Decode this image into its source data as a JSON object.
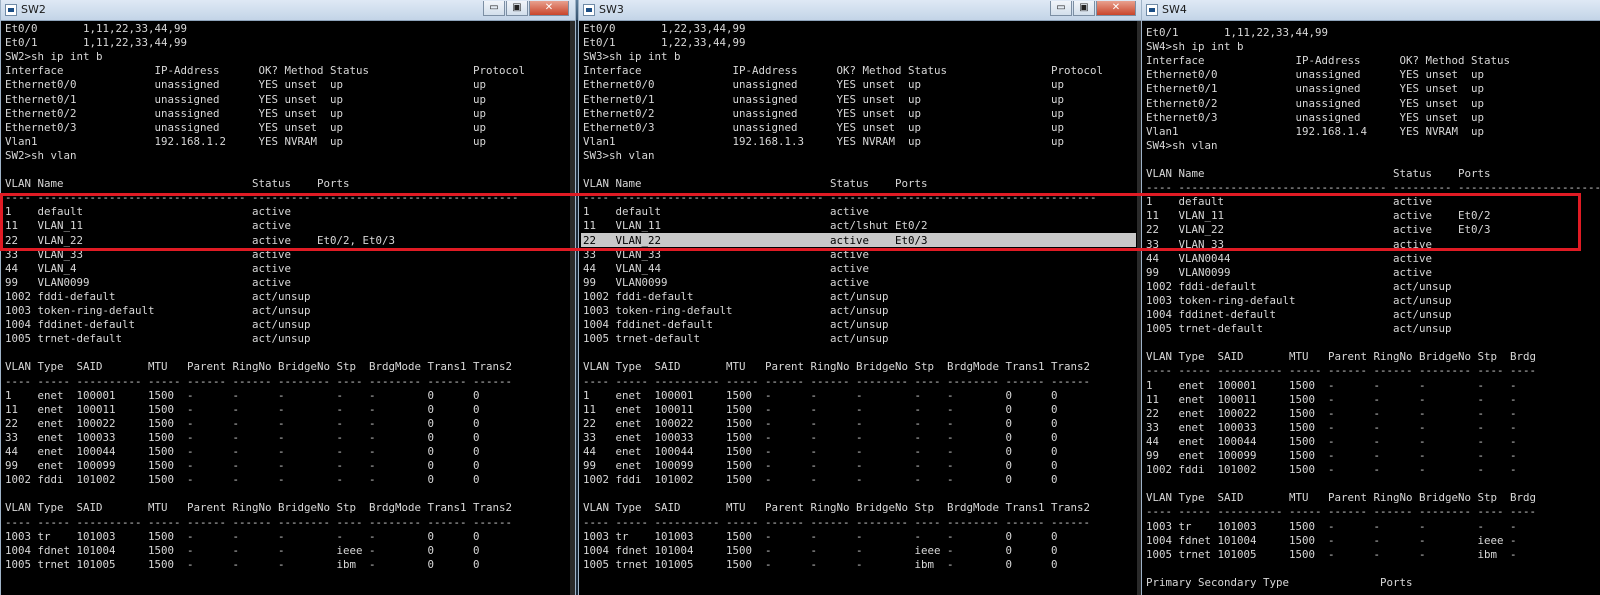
{
  "windows": [
    {
      "id": "sw2",
      "title": "SW2",
      "buttons": {
        "minimize": "▭",
        "restore": "▣",
        "close": "✕"
      },
      "lines": [
        "Et0/0       1,11,22,33,44,99",
        "Et0/1       1,11,22,33,44,99",
        "SW2>sh ip int b",
        "Interface              IP-Address      OK? Method Status                Protocol",
        "Ethernet0/0            unassigned      YES unset  up                    up",
        "Ethernet0/1            unassigned      YES unset  up                    up",
        "Ethernet0/2            unassigned      YES unset  up                    up",
        "Ethernet0/3            unassigned      YES unset  up                    up",
        "Vlan1                  192.168.1.2     YES NVRAM  up                    up",
        "SW2>sh vlan",
        "",
        "VLAN Name                             Status    Ports",
        "---- -------------------------------- --------- -------------------------------",
        "1    default                          active",
        "11   VLAN_11                          active",
        "22   VLAN_22                          active    Et0/2, Et0/3",
        "33   VLAN_33                          active",
        "44   VLAN_4                           active",
        "99   VLAN0099                         active",
        "1002 fddi-default                     act/unsup",
        "1003 token-ring-default               act/unsup",
        "1004 fddinet-default                  act/unsup",
        "1005 trnet-default                    act/unsup",
        "",
        "VLAN Type  SAID       MTU   Parent RingNo BridgeNo Stp  BrdgMode Trans1 Trans2",
        "---- ----- ---------- ----- ------ ------ -------- ---- -------- ------ ------",
        "1    enet  100001     1500  -      -      -        -    -        0      0",
        "11   enet  100011     1500  -      -      -        -    -        0      0",
        "22   enet  100022     1500  -      -      -        -    -        0      0",
        "33   enet  100033     1500  -      -      -        -    -        0      0",
        "44   enet  100044     1500  -      -      -        -    -        0      0",
        "99   enet  100099     1500  -      -      -        -    -        0      0",
        "1002 fddi  101002     1500  -      -      -        -    -        0      0",
        "",
        "VLAN Type  SAID       MTU   Parent RingNo BridgeNo Stp  BrdgMode Trans1 Trans2",
        "---- ----- ---------- ----- ------ ------ -------- ---- -------- ------ ------",
        "1003 tr    101003     1500  -      -      -        -    -        0      0",
        "1004 fdnet 101004     1500  -      -      -        ieee -        0      0",
        "1005 trnet 101005     1500  -      -      -        ibm  -        0      0"
      ]
    },
    {
      "id": "sw3",
      "title": "SW3",
      "buttons": {
        "minimize": "▭",
        "restore": "▣",
        "close": "✕"
      },
      "highlight_line": 15,
      "lines": [
        "Et0/0       1,22,33,44,99",
        "Et0/1       1,22,33,44,99",
        "SW3>sh ip int b",
        "Interface              IP-Address      OK? Method Status                Protocol",
        "Ethernet0/0            unassigned      YES unset  up                    up",
        "Ethernet0/1            unassigned      YES unset  up                    up",
        "Ethernet0/2            unassigned      YES unset  up                    up",
        "Ethernet0/3            unassigned      YES unset  up                    up",
        "Vlan1                  192.168.1.3     YES NVRAM  up                    up",
        "SW3>sh vlan",
        "",
        "VLAN Name                             Status    Ports",
        "---- -------------------------------- --------- -------------------------------",
        "1    default                          active",
        "11   VLAN_11                          act/lshut Et0/2",
        "22   VLAN_22                          active    Et0/3",
        "33   VLAN_33                          active",
        "44   VLAN_44                          active",
        "99   VLAN0099                         active",
        "1002 fddi-default                     act/unsup",
        "1003 token-ring-default               act/unsup",
        "1004 fddinet-default                  act/unsup",
        "1005 trnet-default                    act/unsup",
        "",
        "VLAN Type  SAID       MTU   Parent RingNo BridgeNo Stp  BrdgMode Trans1 Trans2",
        "---- ----- ---------- ----- ------ ------ -------- ---- -------- ------ ------",
        "1    enet  100001     1500  -      -      -        -    -        0      0",
        "11   enet  100011     1500  -      -      -        -    -        0      0",
        "22   enet  100022     1500  -      -      -        -    -        0      0",
        "33   enet  100033     1500  -      -      -        -    -        0      0",
        "44   enet  100044     1500  -      -      -        -    -        0      0",
        "99   enet  100099     1500  -      -      -        -    -        0      0",
        "1002 fddi  101002     1500  -      -      -        -    -        0      0",
        "",
        "VLAN Type  SAID       MTU   Parent RingNo BridgeNo Stp  BrdgMode Trans1 Trans2",
        "---- ----- ---------- ----- ------ ------ -------- ---- -------- ------ ------",
        "1003 tr    101003     1500  -      -      -        -    -        0      0",
        "1004 fdnet 101004     1500  -      -      -        ieee -        0      0",
        "1005 trnet 101005     1500  -      -      -        ibm  -        0      0"
      ]
    },
    {
      "id": "sw4",
      "title": "SW4",
      "buttons": {
        "minimize": "▭",
        "restore": "▣",
        "close": "✕"
      },
      "lines": [
        "Et0/1       1,11,22,33,44,99",
        "SW4>sh ip int b",
        "Interface              IP-Address      OK? Method Status",
        "Ethernet0/0            unassigned      YES unset  up",
        "Ethernet0/1            unassigned      YES unset  up",
        "Ethernet0/2            unassigned      YES unset  up",
        "Ethernet0/3            unassigned      YES unset  up",
        "Vlan1                  192.168.1.4     YES NVRAM  up",
        "SW4>sh vlan",
        "",
        "VLAN Name                             Status    Ports",
        "---- -------------------------------- --------- -------------------------------",
        "1    default                          active",
        "11   VLAN_11                          active    Et0/2",
        "22   VLAN_22                          active    Et0/3",
        "33   VLAN_33                          active",
        "44   VLAN0044                         active",
        "99   VLAN0099                         active",
        "1002 fddi-default                     act/unsup",
        "1003 token-ring-default               act/unsup",
        "1004 fddinet-default                  act/unsup",
        "1005 trnet-default                    act/unsup",
        "",
        "VLAN Type  SAID       MTU   Parent RingNo BridgeNo Stp  Brdg",
        "---- ----- ---------- ----- ------ ------ -------- ---- ----",
        "1    enet  100001     1500  -      -      -        -    -",
        "11   enet  100011     1500  -      -      -        -    -",
        "22   enet  100022     1500  -      -      -        -    -",
        "33   enet  100033     1500  -      -      -        -    -",
        "44   enet  100044     1500  -      -      -        -    -",
        "99   enet  100099     1500  -      -      -        -    -",
        "1002 fddi  101002     1500  -      -      -        -    -",
        "",
        "VLAN Type  SAID       MTU   Parent RingNo BridgeNo Stp  Brdg",
        "---- ----- ---------- ----- ------ ------ -------- ---- ----",
        "1003 tr    101003     1500  -      -      -        -    -",
        "1004 fdnet 101004     1500  -      -      -        ieee -",
        "1005 trnet 101005     1500  -      -      -        ibm  -",
        "",
        "Primary Secondary Type              Ports"
      ]
    }
  ],
  "annotation": {
    "color": "#e01b24"
  }
}
